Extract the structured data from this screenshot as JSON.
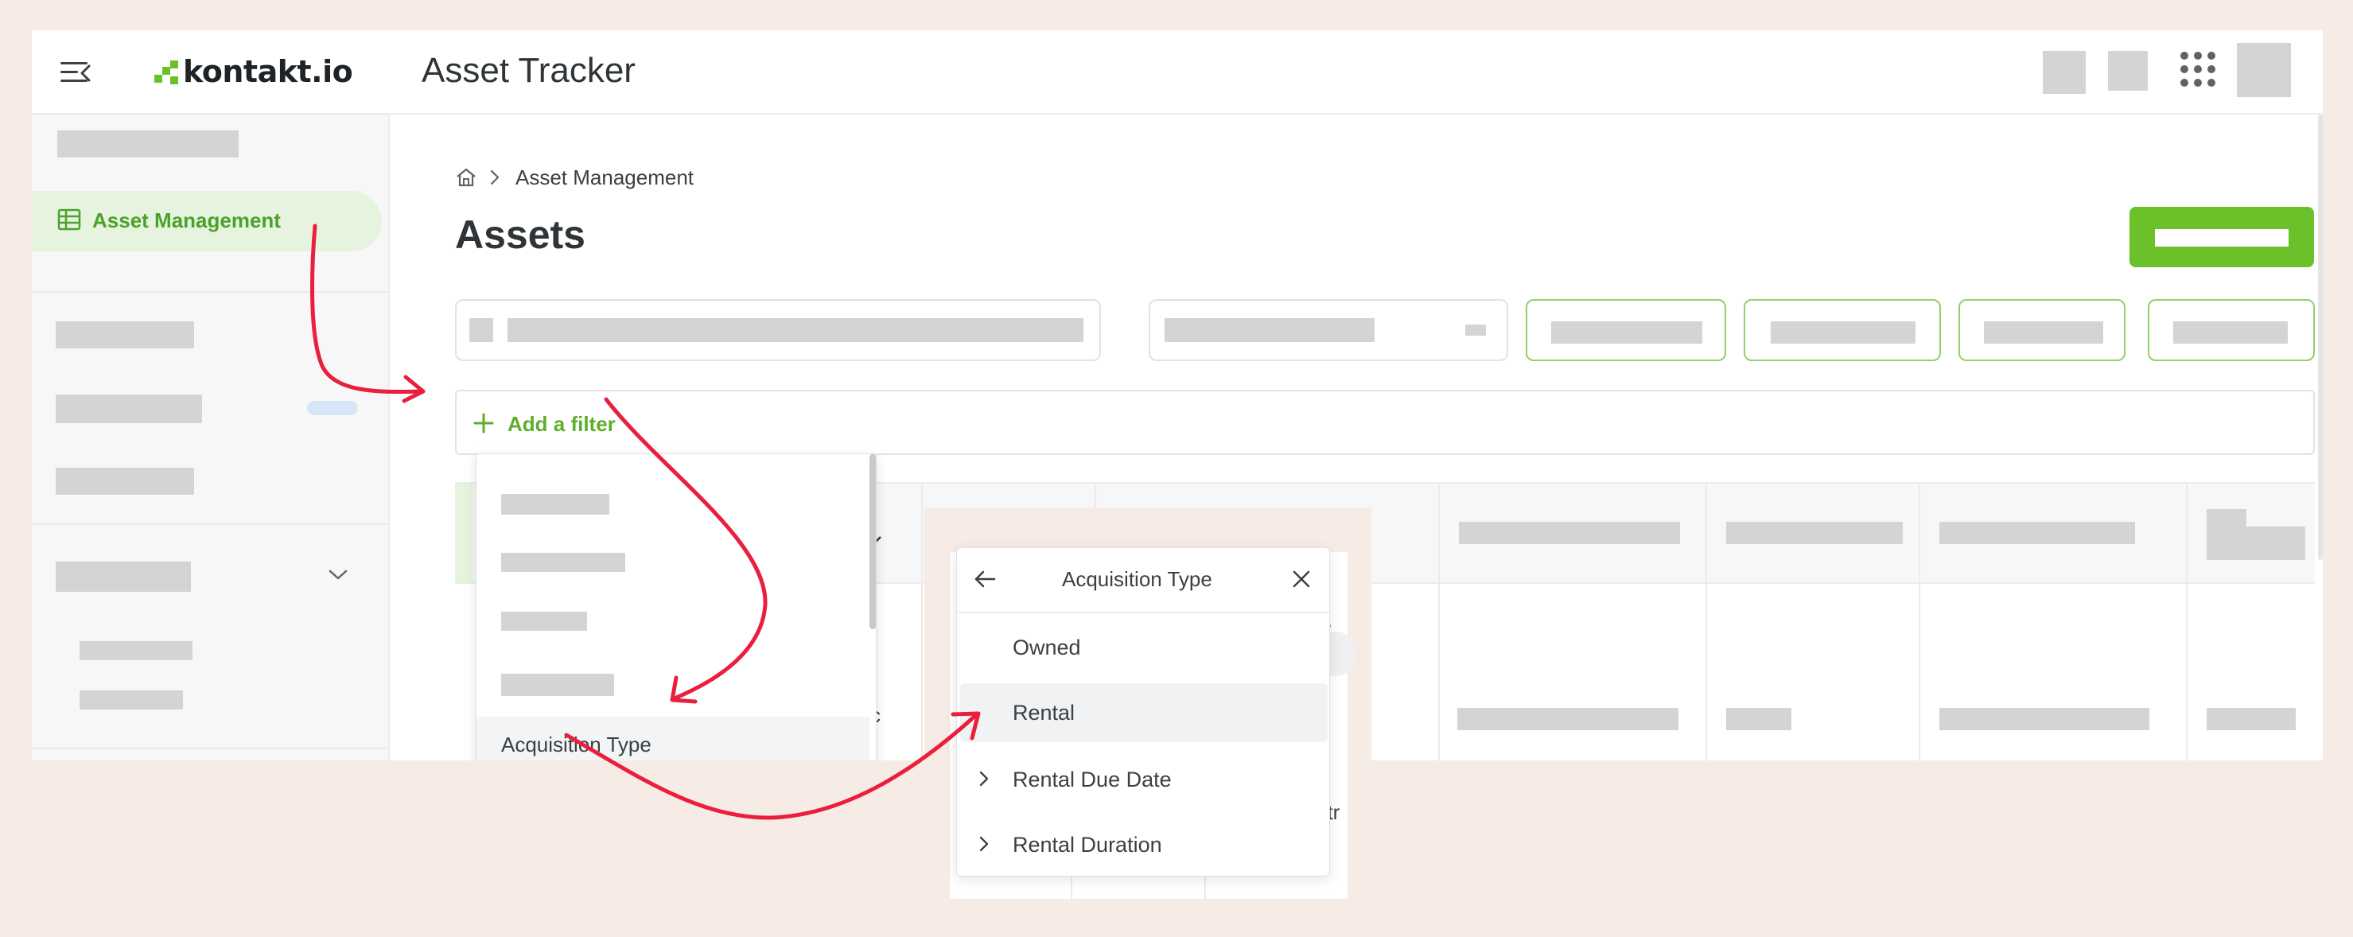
{
  "app": {
    "brand": "kontakt.io",
    "title": "Asset Tracker"
  },
  "sidebar": {
    "active_item": "Asset Management"
  },
  "breadcrumb": {
    "current": "Asset Management"
  },
  "page": {
    "title": "Assets"
  },
  "filter": {
    "add_label": "Add a filter"
  },
  "filter_dropdown": {
    "highlighted_item": "Acquisition Type"
  },
  "table": {
    "partial_texts": [
      "c",
      "e",
      "atr"
    ]
  },
  "acquisition_popup": {
    "title": "Acquisition Type",
    "options": [
      {
        "label": "Owned",
        "expandable": false,
        "selected": false
      },
      {
        "label": "Rental",
        "expandable": false,
        "selected": true
      },
      {
        "label": "Rental Due Date",
        "expandable": true,
        "selected": false
      },
      {
        "label": "Rental Duration",
        "expandable": true,
        "selected": false
      }
    ]
  },
  "colors": {
    "brand_green": "#6cc02a",
    "accent_red": "#ea1f3d",
    "background": "#f6ebe5"
  }
}
